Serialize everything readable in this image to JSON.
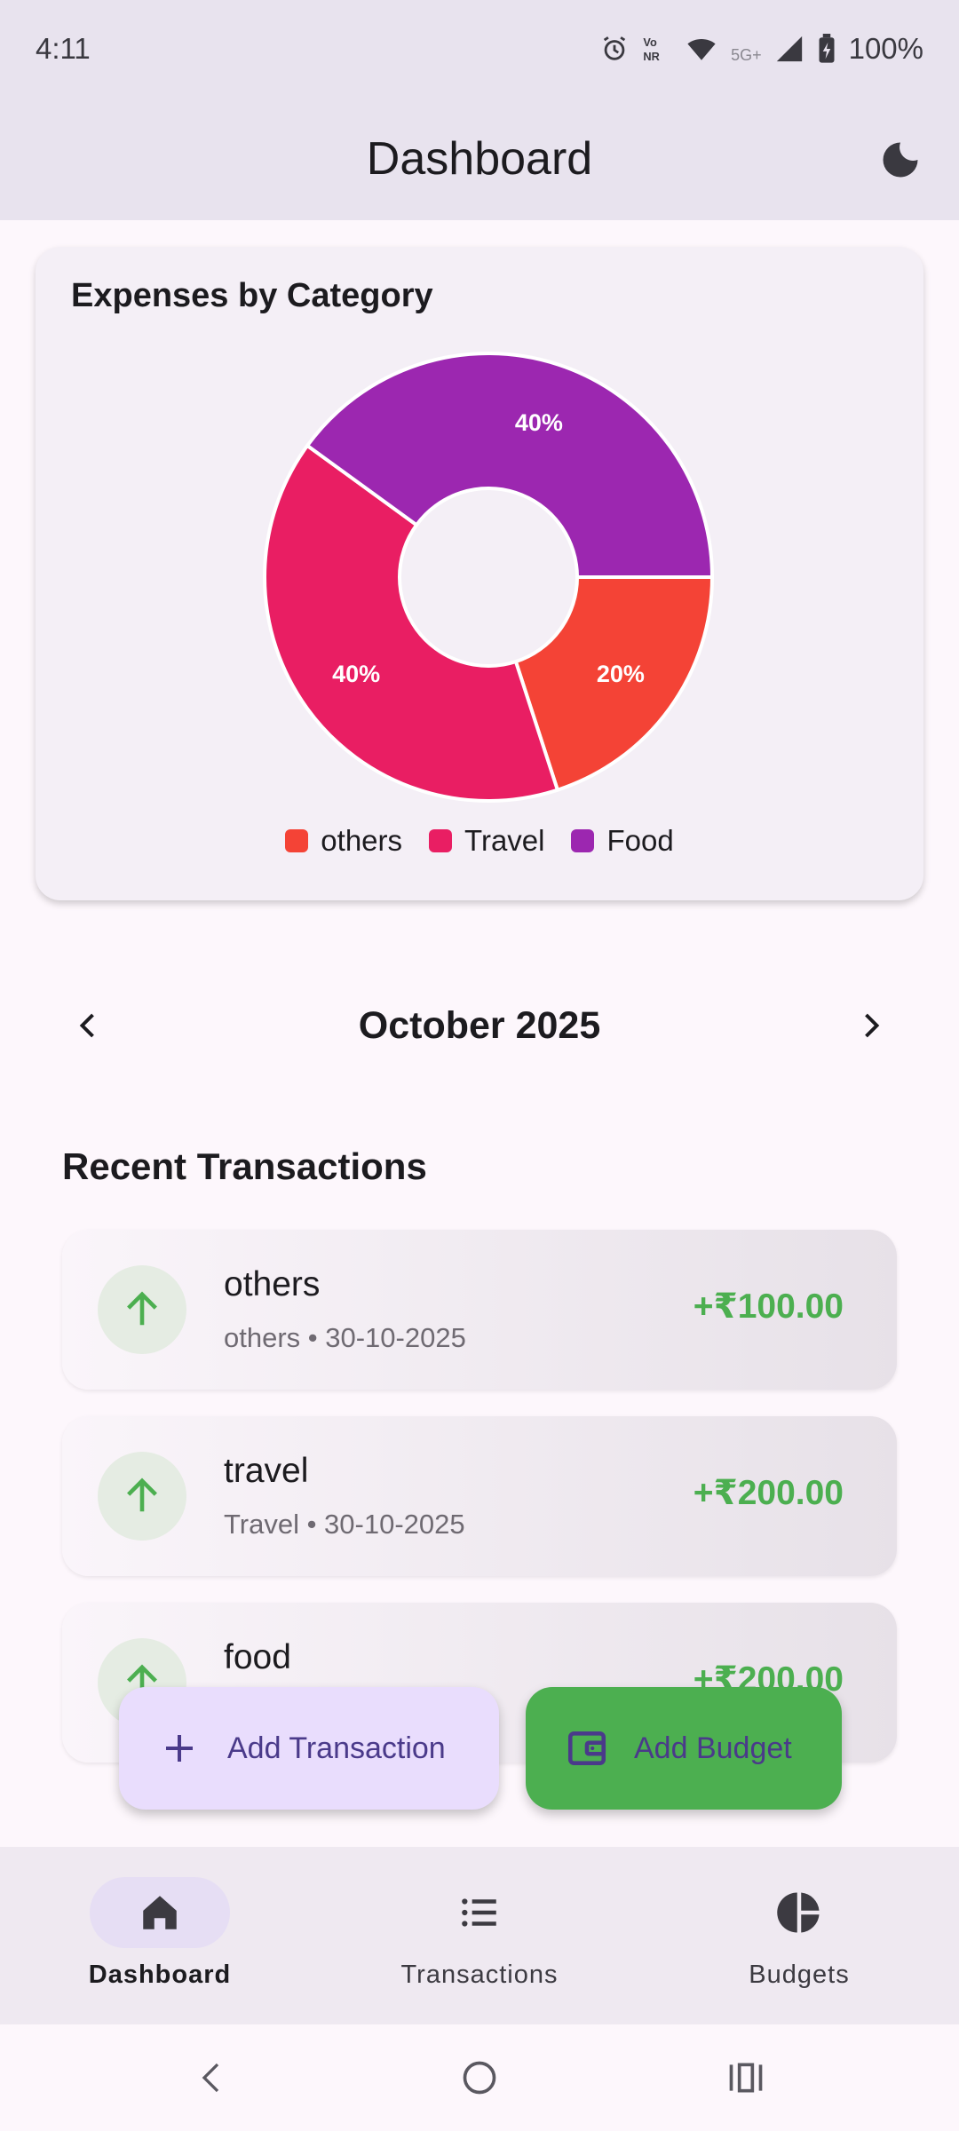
{
  "status_bar": {
    "time": "4:11",
    "network": "5G+",
    "battery": "100%",
    "icons": [
      "alarm-icon",
      "vonr-icon",
      "wifi-icon",
      "signal-icon",
      "battery-icon"
    ]
  },
  "app_bar": {
    "title": "Dashboard",
    "theme_icon": "moon-icon"
  },
  "expenses_card": {
    "title": "Expenses by Category"
  },
  "chart_data": {
    "type": "pie",
    "title": "Expenses by Category",
    "categories": [
      "others",
      "Travel",
      "Food"
    ],
    "values": [
      20,
      40,
      40
    ],
    "labels": [
      "20%",
      "40%",
      "40%"
    ],
    "colors": [
      "#f44336",
      "#e91e63",
      "#9c27b0"
    ],
    "donut": true,
    "legend": "bottom"
  },
  "month_nav": {
    "label": "October 2025",
    "prev_icon": "chevron-left-icon",
    "next_icon": "chevron-right-icon"
  },
  "recent": {
    "title": "Recent Transactions",
    "items": [
      {
        "title": "others",
        "subtitle": "others • 30-10-2025",
        "amount": "+₹100.00",
        "icon": "arrow-up-icon"
      },
      {
        "title": "travel",
        "subtitle": "Travel • 30-10-2025",
        "amount": "+₹200.00",
        "icon": "arrow-up-icon"
      },
      {
        "title": "food",
        "subtitle": "",
        "amount": "+₹200.00",
        "icon": "arrow-up-icon"
      }
    ]
  },
  "fabs": {
    "add_transaction": "Add Transaction",
    "add_budget": "Add Budget"
  },
  "bottom_nav": {
    "items": [
      {
        "label": "Dashboard",
        "icon": "home-icon",
        "active": true
      },
      {
        "label": "Transactions",
        "icon": "list-icon",
        "active": false
      },
      {
        "label": "Budgets",
        "icon": "pie-chart-icon",
        "active": false
      }
    ]
  },
  "colors": {
    "accent": "#4caf50",
    "fab_purple": "#e9ddfd",
    "appbar": "#e8e3ee"
  }
}
